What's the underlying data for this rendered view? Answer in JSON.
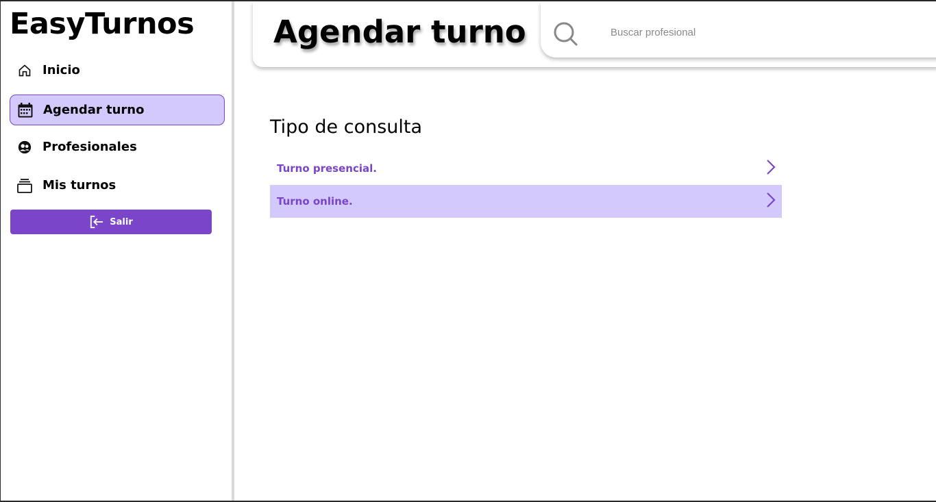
{
  "app": {
    "name": "EasyTurnos"
  },
  "sidebar": {
    "items": [
      {
        "label": "Inicio",
        "icon": "home-icon"
      },
      {
        "label": "Agendar turno",
        "icon": "calendar-icon",
        "active": true
      },
      {
        "label": "Profesionales",
        "icon": "user-circle-icon"
      },
      {
        "label": "Mis turnos",
        "icon": "stack-icon"
      }
    ],
    "logout_label": "Salir",
    "logout_icon": "logout-icon"
  },
  "header": {
    "title": "Agendar turno",
    "search_placeholder": "Buscar profesional",
    "search_value": ""
  },
  "main": {
    "section_title": "Tipo de consulta",
    "options": [
      {
        "label": "Turno presencial.",
        "selected": false,
        "icon": "chevron-right-icon"
      },
      {
        "label": "Turno online.",
        "selected": true,
        "icon": "chevron-right-icon"
      }
    ]
  },
  "colors": {
    "accent": "#7a45c9",
    "active_bg": "#d3c9fc",
    "divider": "#d9d9d9"
  }
}
